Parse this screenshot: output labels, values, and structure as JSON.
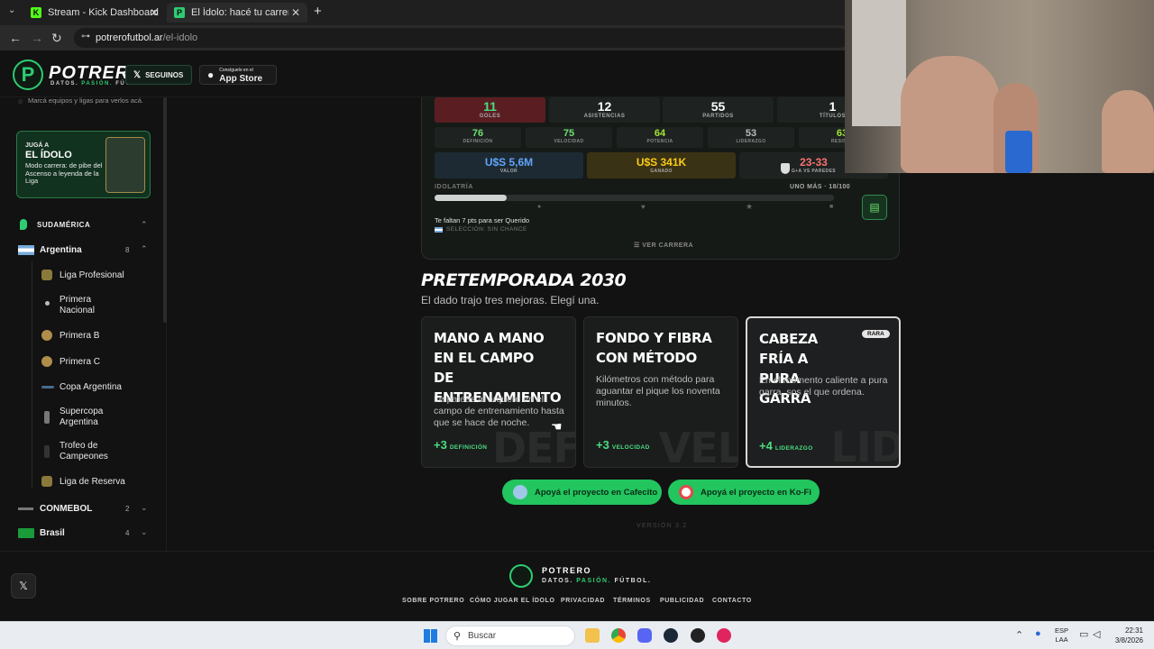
{
  "browser": {
    "tabs": [
      {
        "title": "Stream - Kick Dashboard",
        "favicon_letter": "K",
        "color": "#53fc18"
      },
      {
        "title": "El Ídolo: hacé tu carrera en la Li",
        "favicon_letter": "P",
        "color": "#2ecc71"
      }
    ],
    "new_tab": "+",
    "url_host": "potrerofutbol.ar",
    "url_path": "/el-idolo"
  },
  "header": {
    "logo_letter": "P",
    "brand": "POTRERO",
    "tagline_a": "DATOS.",
    "tagline_b": "PASIÓN.",
    "tagline_c": "FÚTBOL.",
    "follow_label": "SEGUINOS",
    "store_small": "Consíguelo en el",
    "store_big": "App Store"
  },
  "sidebar": {
    "hint": "Marcá equipos y ligas para verlos acá.",
    "promo": {
      "line1": "JUGÁ A",
      "line2": "EL ÍDOLO",
      "text": "Modo carrera: de pibe del Ascenso a leyenda de la Liga"
    },
    "region": "SUDAMÉRICA",
    "country": {
      "name": "Argentina",
      "count": "8"
    },
    "leagues": [
      {
        "name": "Liga Profesional"
      },
      {
        "name": "Primera Nacional"
      },
      {
        "name": "Primera B"
      },
      {
        "name": "Primera C"
      },
      {
        "name": "Copa Argentina"
      },
      {
        "name": "Supercopa Argentina"
      },
      {
        "name": "Trofeo de Campeones"
      },
      {
        "name": "Liga de Reserva"
      }
    ],
    "groups": [
      {
        "name": "CONMEBOL",
        "count": "2"
      },
      {
        "name": "Brasil",
        "count": "4"
      }
    ],
    "x_button": "𝕏"
  },
  "career": {
    "stats": [
      {
        "value": "11",
        "label": "GOLES"
      },
      {
        "value": "12",
        "label": "ASISTENCIAS"
      },
      {
        "value": "55",
        "label": "PARTIDOS"
      },
      {
        "value": "1",
        "label": "TÍTULOS"
      }
    ],
    "attributes": [
      {
        "value": "76",
        "label": "DEFINICIÓN"
      },
      {
        "value": "75",
        "label": "VELOCIDAD"
      },
      {
        "value": "64",
        "label": "POTENCIA"
      },
      {
        "value": "53",
        "label": "LIDERAZGO"
      },
      {
        "value": "63",
        "label": "RESISTE"
      }
    ],
    "money": [
      {
        "value": "U$S 5,6M",
        "label": "VALOR",
        "color": "#60a5fa"
      },
      {
        "value": "U$S 341K",
        "label": "GANADO",
        "color": "#facc15"
      },
      {
        "value": "23-33",
        "label": "G+A VS PAREDES",
        "color": "#f87171"
      }
    ],
    "idolatria_label": "IDOLATRÍA",
    "idolatria_status": "UNO MÁS · 18/100",
    "idolatria_fraction": 0.18,
    "need_text": "Te faltan 7 pts para ser Querido",
    "selection": "SELECCIÓN: SIN CHANCE",
    "view_career": "VER CARRERA"
  },
  "preseason": {
    "title": "PRETEMPORADA 2030",
    "subtitle": "El dado trajo tres mejoras. Elegí una.",
    "options": [
      {
        "title": "MANO A MANO EN EL CAMPO DE ENTRENAMIENTO",
        "desc": "Le pateás al arquero en el campo de entrenamiento hasta que se hace de noche.",
        "bonus": "+3",
        "stat": "DEFINICIÓN",
        "watermark": "DEF",
        "badge": ""
      },
      {
        "title": "FONDO Y FIBRA CON MÉTODO",
        "desc": "Kilómetros con método para aguantar el pique los noventa minutos.",
        "bonus": "+3",
        "stat": "VELOCIDAD",
        "watermark": "VEL",
        "badge": ""
      },
      {
        "title": "CABEZA FRÍA A PURA GARRA",
        "desc": "En el momento caliente a pura garra, sos el que ordena.",
        "bonus": "+4",
        "stat": "LIDERAZGO",
        "watermark": "LID",
        "badge": "RARA"
      }
    ],
    "donate_cafecito": "Apoyá el proyecto en Cafecito",
    "donate_kofi": "Apoyá el proyecto en Ko-Fi",
    "version": "VERSIÓN 3.2"
  },
  "footer": {
    "brand": "POTRERO",
    "tag_a": "DATOS.",
    "tag_b": "PASIÓN.",
    "tag_c": "FÚTBOL.",
    "links": [
      "SOBRE POTRERO",
      "CÓMO JUGAR EL ÍDOLO",
      "PRIVACIDAD",
      "TÉRMINOS",
      "PUBLICIDAD",
      "CONTACTO"
    ]
  },
  "taskbar": {
    "search_placeholder": "Buscar",
    "lang_top": "ESP",
    "lang_bottom": "LAA",
    "time": "22:31",
    "date": "3/8/2026"
  }
}
